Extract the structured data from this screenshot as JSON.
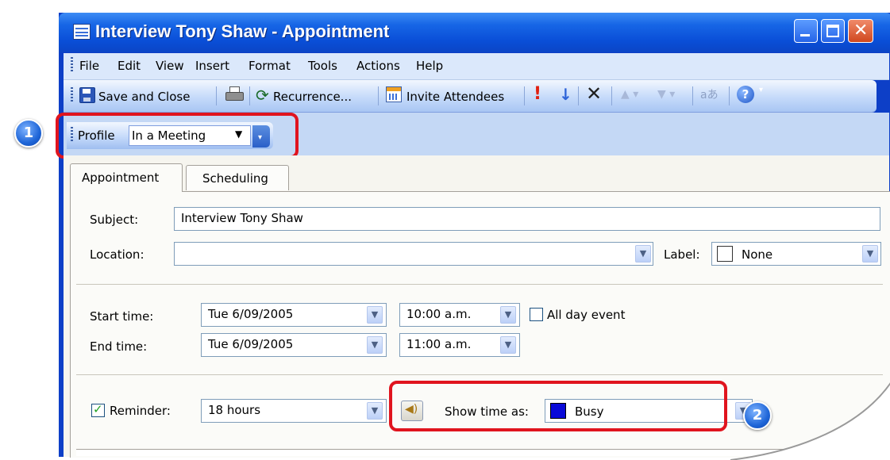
{
  "window": {
    "title": "Interview Tony Shaw - Appointment"
  },
  "menu": {
    "items": [
      "File",
      "Edit",
      "View",
      "Insert",
      "Format",
      "Tools",
      "Actions",
      "Help"
    ]
  },
  "toolbar": {
    "save_close": "Save and Close",
    "recurrence": "Recurrence...",
    "invite": "Invite Attendees"
  },
  "profile": {
    "label": "Profile",
    "value": "In a Meeting"
  },
  "tabs": [
    "Appointment",
    "Scheduling"
  ],
  "form": {
    "subject_label": "Subject:",
    "subject_value": "Interview Tony Shaw",
    "location_label": "Location:",
    "location_value": "",
    "label_label": "Label:",
    "label_value": "None",
    "start_label": "Start time:",
    "start_date": "Tue 6/09/2005",
    "start_time": "10:00 a.m.",
    "all_day_label": "All day event",
    "end_label": "End time:",
    "end_date": "Tue 6/09/2005",
    "end_time": "11:00 a.m.",
    "reminder_label": "Reminder:",
    "reminder_checked": true,
    "reminder_value": "18 hours",
    "show_time_label": "Show time as:",
    "show_time_value": "Busy",
    "busy_color": "#0a0ad8"
  },
  "callouts": [
    "1",
    "2"
  ],
  "colors": {
    "highlight": "#e0141e",
    "title_bar": "#0b45c6"
  }
}
